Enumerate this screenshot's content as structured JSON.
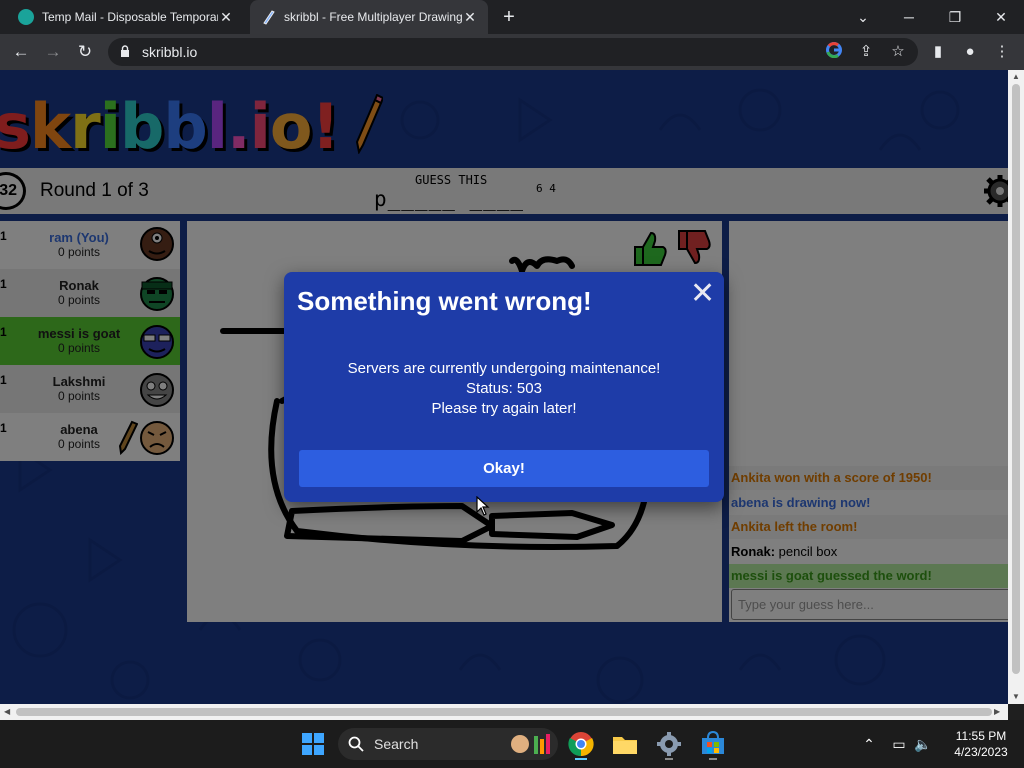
{
  "browser": {
    "tabs": [
      {
        "title": "Temp Mail - Disposable Temporary",
        "active": false
      },
      {
        "title": "skribbl - Free Multiplayer Drawing",
        "active": true
      }
    ],
    "url": "skribbl.io"
  },
  "game": {
    "logo_text": "skribbl.io",
    "timer": "32",
    "round": "Round 1 of 3",
    "guess_label": "GUESS THIS",
    "word": "p_____ ____",
    "word_lengths": "6 4",
    "players": [
      {
        "rank": "1",
        "name": "ram (You)",
        "points": "0 points",
        "you": true
      },
      {
        "rank": "1",
        "name": "Ronak",
        "points": "0 points"
      },
      {
        "rank": "1",
        "name": "messi is goat",
        "points": "0 points",
        "guessed": true
      },
      {
        "rank": "1",
        "name": "Lakshmi",
        "points": "0 points"
      },
      {
        "rank": "1",
        "name": "abena",
        "points": "0 points",
        "drawing": true
      }
    ],
    "chat": [
      {
        "name": "",
        "text": "Ankita won with a score of 1950!",
        "style": "orange"
      },
      {
        "name": "",
        "text": "abena is drawing now!",
        "style": "blue"
      },
      {
        "name": "",
        "text": "Ankita left the room!",
        "style": "orange"
      },
      {
        "name": "Ronak:",
        "text": " pencil box",
        "style": "plain"
      },
      {
        "name": "",
        "text": "messi is goat guessed the word!",
        "style": "green"
      }
    ],
    "chat_placeholder": "Type your guess here..."
  },
  "modal": {
    "title": "Something went wrong!",
    "close": "✕",
    "line1": "Servers are currently undergoing maintenance!",
    "line2": "Status: 503",
    "line3": "Please try again later!",
    "button": "Okay!"
  },
  "taskbar": {
    "search": "Search",
    "time": "11:55 PM",
    "date": "4/23/2023"
  },
  "colors": {
    "page_bg": "#1b3a8f",
    "modal_bg": "#1e3ca8",
    "button": "#2d5ee0",
    "guessed": "#5bd135"
  }
}
